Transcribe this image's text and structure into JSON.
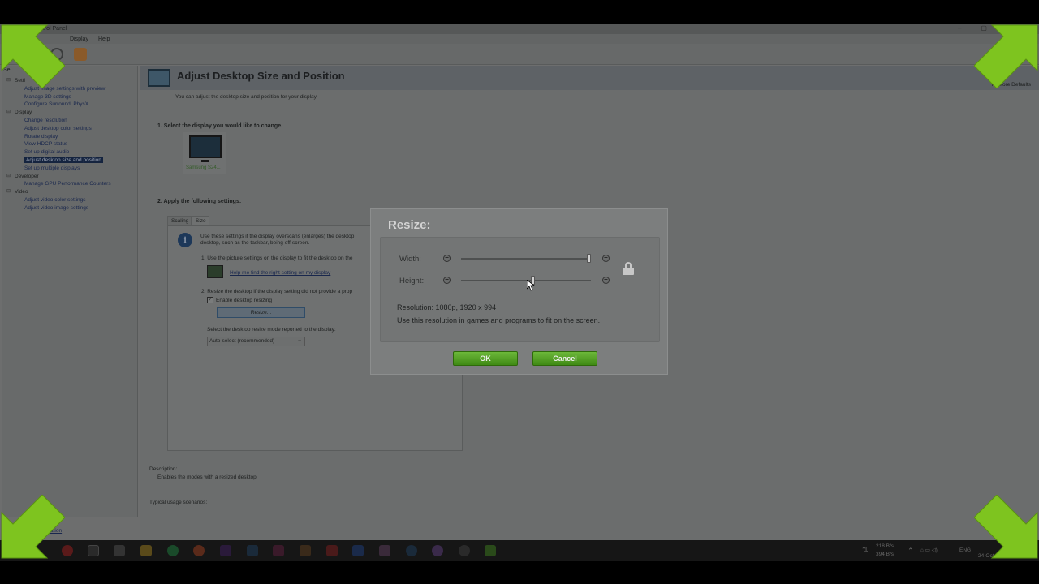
{
  "window": {
    "title": "Control Panel"
  },
  "menu": {
    "items": [
      "Display",
      "Help"
    ]
  },
  "sidebar": {
    "header": "Se",
    "tree": [
      {
        "type": "cat",
        "label": "Setti"
      },
      {
        "type": "item",
        "label": "Adjust image settings with preview"
      },
      {
        "type": "item",
        "label": "Manage 3D settings"
      },
      {
        "type": "item",
        "label": "Configure Surround, PhysX"
      },
      {
        "type": "cat",
        "label": "Display"
      },
      {
        "type": "item",
        "label": "Change resolution"
      },
      {
        "type": "item",
        "label": "Adjust desktop color settings"
      },
      {
        "type": "item",
        "label": "Rotate display"
      },
      {
        "type": "item",
        "label": "View HDCP status"
      },
      {
        "type": "item",
        "label": "Set up digital audio"
      },
      {
        "type": "item",
        "label": "Adjust desktop size and position",
        "selected": true
      },
      {
        "type": "item",
        "label": "Set up multiple displays"
      },
      {
        "type": "cat",
        "label": "Developer"
      },
      {
        "type": "item",
        "label": "Manage GPU Performance Counters"
      },
      {
        "type": "cat",
        "label": "Video"
      },
      {
        "type": "item",
        "label": "Adjust video color settings"
      },
      {
        "type": "item",
        "label": "Adjust video image settings"
      }
    ],
    "bottom_link": "ation"
  },
  "main": {
    "title": "Adjust Desktop Size and Position",
    "restore_defaults": "Restore Defaults",
    "subtitle": "You can adjust the desktop size and position for your display.",
    "step1": "1. Select the display you would like to change.",
    "display_name": "Samsung S24...",
    "step2": "2. Apply the following settings:",
    "tabs": [
      "Scaling",
      "Size"
    ],
    "info_line1": "Use these settings if the display overscans (enlarges) the desktop",
    "info_line2": "desktop, such as the taskbar, being off-screen.",
    "bullet1": "1. Use the picture settings on the display to fit the desktop on the",
    "help_link": "Help me find the right setting on my display",
    "bullet2": "2. Resize the desktop if the display setting did not provide a prop",
    "enable_resizing": "Enable desktop resizing",
    "resize_button": "Resize...",
    "mode_label": "Select the desktop resize mode reported to the display:",
    "mode_value": "Auto-select (recommended)",
    "description_head": "Description:",
    "description_body": "Enables the modes with a resized desktop.",
    "usage_head": "Typical usage scenarios:"
  },
  "dialog": {
    "title": "Resize:",
    "width_label": "Width:",
    "height_label": "Height:",
    "width_value": 0.98,
    "height_value": 0.55,
    "resolution": "Resolution: 1080p, 1920 x 994",
    "hint": "Use this resolution in games and programs to fit on the screen.",
    "ok": "OK",
    "cancel": "Cancel"
  },
  "taskbar": {
    "net_up": "218 B/s",
    "net_down": "394 B/s",
    "lang": "ENG",
    "date": "24-Oct-20"
  },
  "icons": {
    "corner_arrows": "corner-arrow-icon",
    "colors": {
      "arrow": "#7ec41f",
      "button_green": "#4f9e1e"
    }
  }
}
